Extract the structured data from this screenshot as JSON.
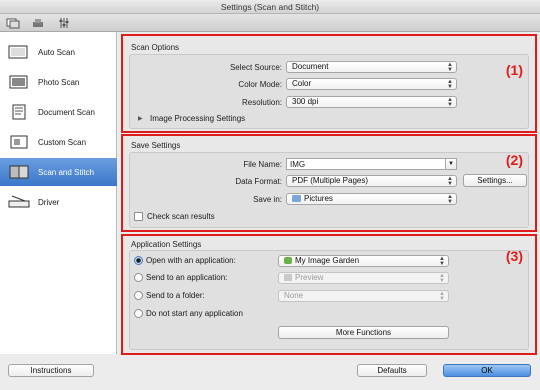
{
  "window": {
    "title": "Settings (Scan and Stitch)"
  },
  "toolbar": {
    "icons": [
      "scan-from-computer-icon",
      "scan-from-panel-icon",
      "general-settings-icon"
    ]
  },
  "sidebar": {
    "items": [
      {
        "label": "Auto Scan",
        "icon": "auto-scan-icon",
        "active": false
      },
      {
        "label": "Photo Scan",
        "icon": "photo-scan-icon",
        "active": false
      },
      {
        "label": "Document Scan",
        "icon": "document-scan-icon",
        "active": false
      },
      {
        "label": "Custom Scan",
        "icon": "custom-scan-icon",
        "active": false
      },
      {
        "label": "Scan and Stitch",
        "icon": "scan-and-stitch-icon",
        "active": true
      },
      {
        "label": "Driver",
        "icon": "driver-icon",
        "active": false
      }
    ]
  },
  "scan_options": {
    "title": "Scan Options",
    "number": "(1)",
    "select_source_label": "Select Source:",
    "select_source_value": "Document",
    "color_mode_label": "Color Mode:",
    "color_mode_value": "Color",
    "resolution_label": "Resolution:",
    "resolution_value": "300 dpi",
    "image_processing_label": "Image Processing Settings"
  },
  "save_settings": {
    "title": "Save Settings",
    "number": "(2)",
    "file_name_label": "File Name:",
    "file_name_value": "IMG",
    "data_format_label": "Data Format:",
    "data_format_value": "PDF (Multiple Pages)",
    "settings_button": "Settings...",
    "save_in_label": "Save in:",
    "save_in_value": "Pictures",
    "check_scan_results_label": "Check scan results"
  },
  "application_settings": {
    "title": "Application Settings",
    "number": "(3)",
    "open_with_label": "Open with an application:",
    "open_with_value": "My Image Garden",
    "send_to_app_label": "Send to an application:",
    "send_to_app_value": "Preview",
    "send_to_folder_label": "Send to a folder:",
    "send_to_folder_value": "None",
    "do_not_start_label": "Do not start any application",
    "more_functions_button": "More Functions",
    "selected_option": "open_with"
  },
  "footer": {
    "instructions_button": "Instructions",
    "defaults_button": "Defaults",
    "ok_button": "OK"
  },
  "colors": {
    "highlight_border": "#e01b1b",
    "sidebar_active": "#3b76c9"
  }
}
